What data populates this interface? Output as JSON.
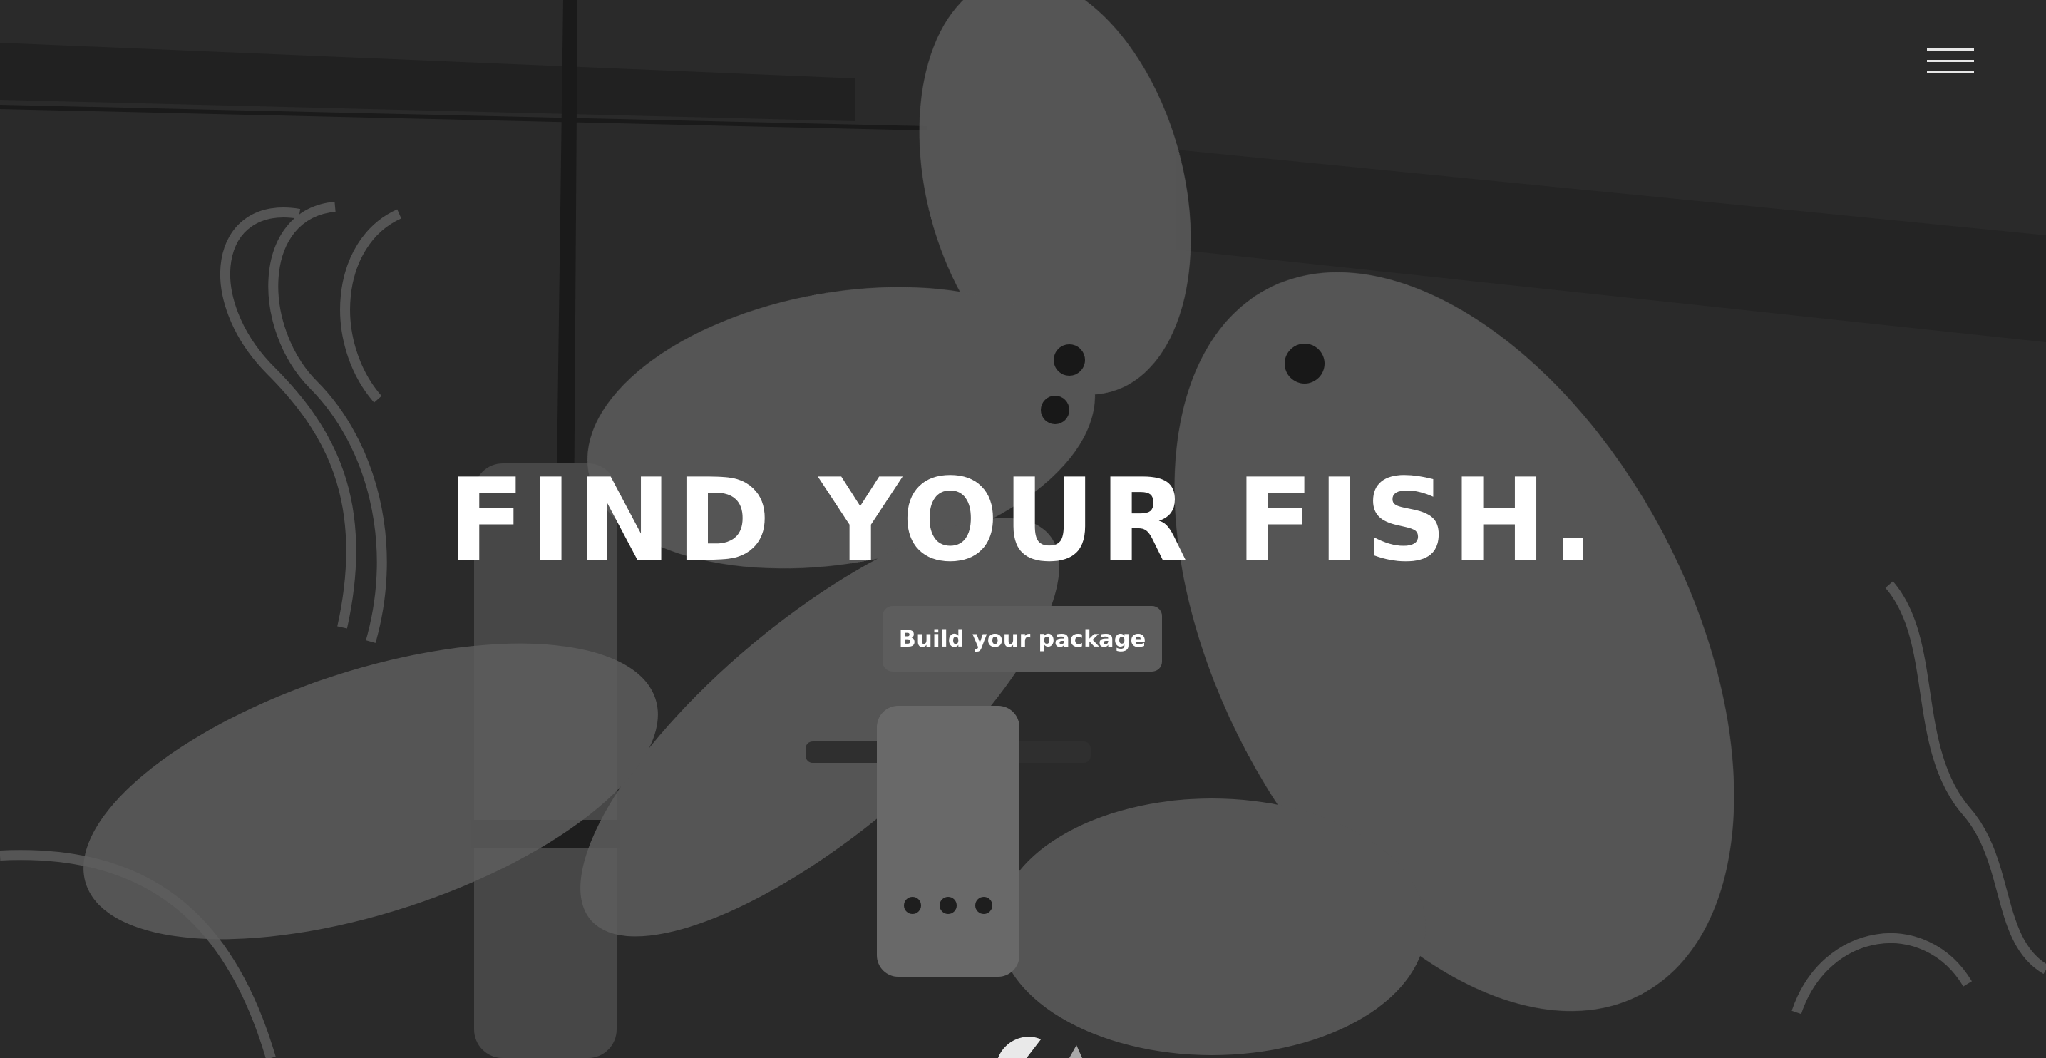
{
  "hero": {
    "title": "FIND YOUR FISH.",
    "cta_label": "Build your package"
  },
  "icons": {
    "menu": "hamburger-menu-icon",
    "scroll": "scroll-down-indicator"
  },
  "colors": {
    "text": "#ffffff",
    "button_bg": "#5d5d5d",
    "menu_lines": "#e6e6e6",
    "background": "#2b2b2b"
  }
}
